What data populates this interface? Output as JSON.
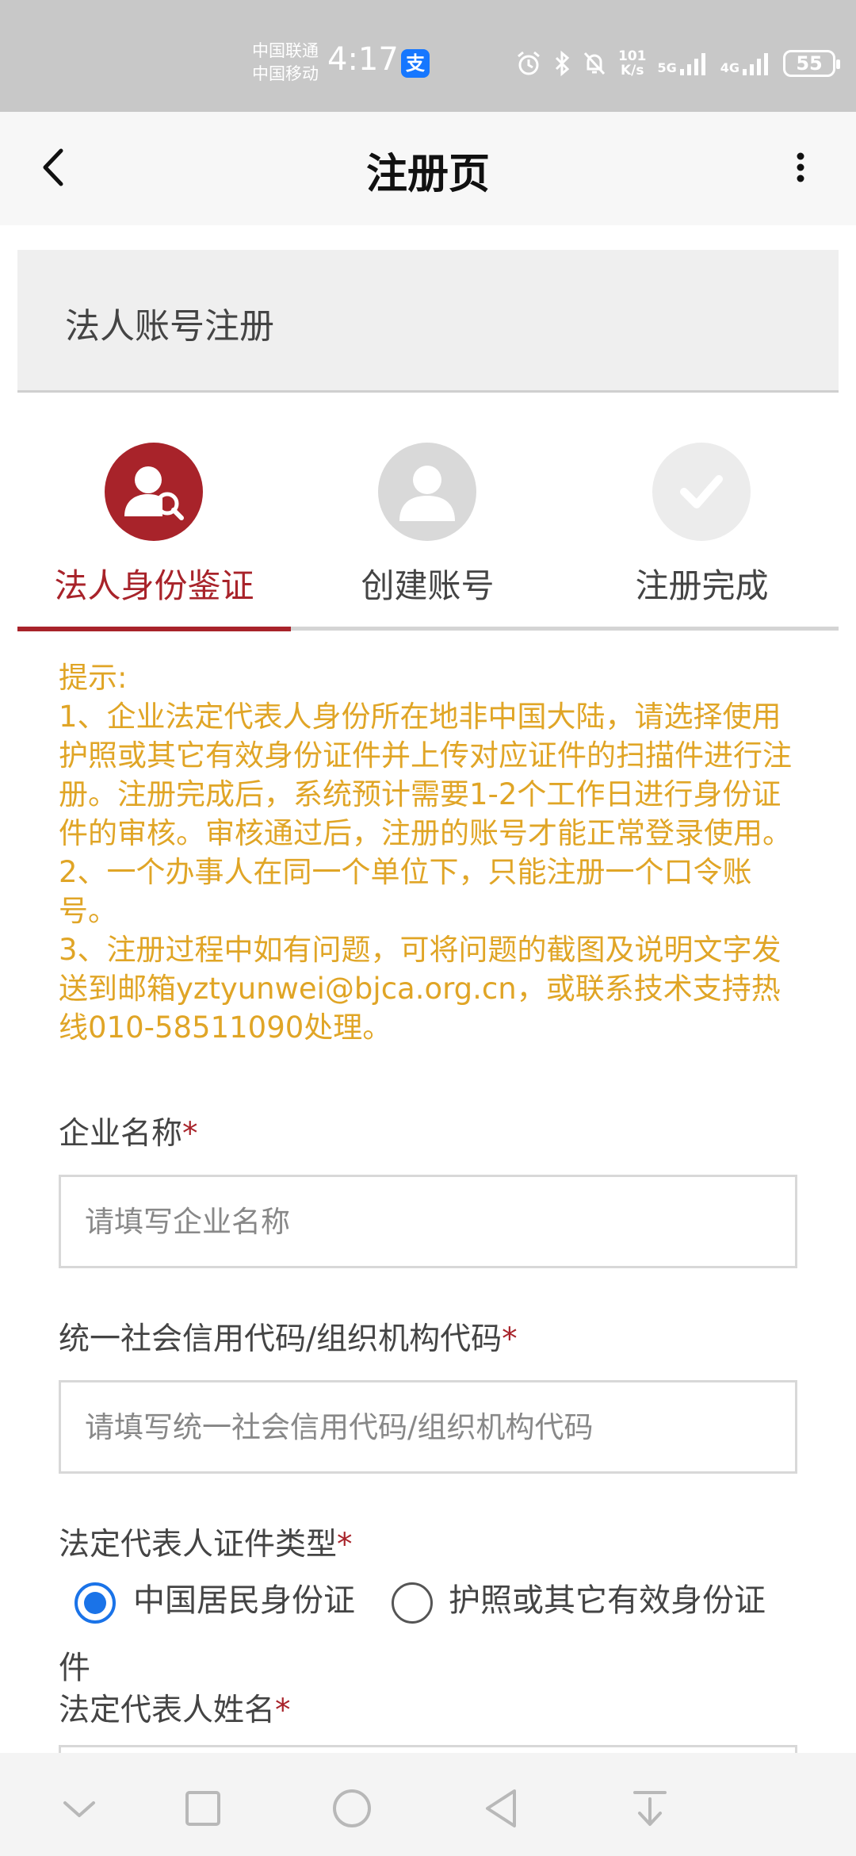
{
  "status_bar": {
    "carrier_1": "中国联通",
    "carrier_2": "中国移动",
    "time": "4:17",
    "net_speed_value": "101",
    "net_speed_unit": "K/s",
    "signal_1": "5G",
    "signal_2": "4G",
    "battery": "55"
  },
  "app_bar": {
    "title": "注册页"
  },
  "section": {
    "title": "法人账号注册"
  },
  "steps": [
    {
      "label": "法人身份鉴证",
      "active": true
    },
    {
      "label": "创建账号",
      "active": false
    },
    {
      "label": "注册完成",
      "active": false
    }
  ],
  "notice": {
    "heading": "提示:",
    "item_1": "1、企业法定代表人身份所在地非中国大陆，请选择使用护照或其它有效身份证件并上传对应证件的扫描件进行注册。注册完成后，系统预计需要1-2个工作日进行身份证件的审核。审核通过后，注册的账号才能正常登录使用。",
    "item_2": "2、一个办事人在同一个单位下，只能注册一个口令账号。",
    "item_3": "3、注册过程中如有问题，可将问题的截图及说明文字发送到邮箱yztyunwei@bjca.org.cn，或联系技术支持热线010-58511090处理。"
  },
  "form": {
    "company_name": {
      "label": "企业名称",
      "required_mark": "*",
      "placeholder": "请填写企业名称",
      "value": ""
    },
    "credit_code": {
      "label": "统一社会信用代码/组织机构代码",
      "required_mark": "*",
      "placeholder": "请填写统一社会信用代码/组织机构代码",
      "value": ""
    },
    "id_type": {
      "label": "法定代表人证件类型",
      "required_mark": "*",
      "options": [
        "中国居民身份证",
        "护照或其它有效身份证"
      ],
      "option_2_wrap": "件",
      "selected": "中国居民身份证"
    },
    "legal_rep_name": {
      "label": "法定代表人姓名",
      "required_mark": "*"
    }
  },
  "colors": {
    "accent_red": "#a8232a",
    "notice_yellow": "#e0a526",
    "radio_blue": "#1a73e8"
  }
}
